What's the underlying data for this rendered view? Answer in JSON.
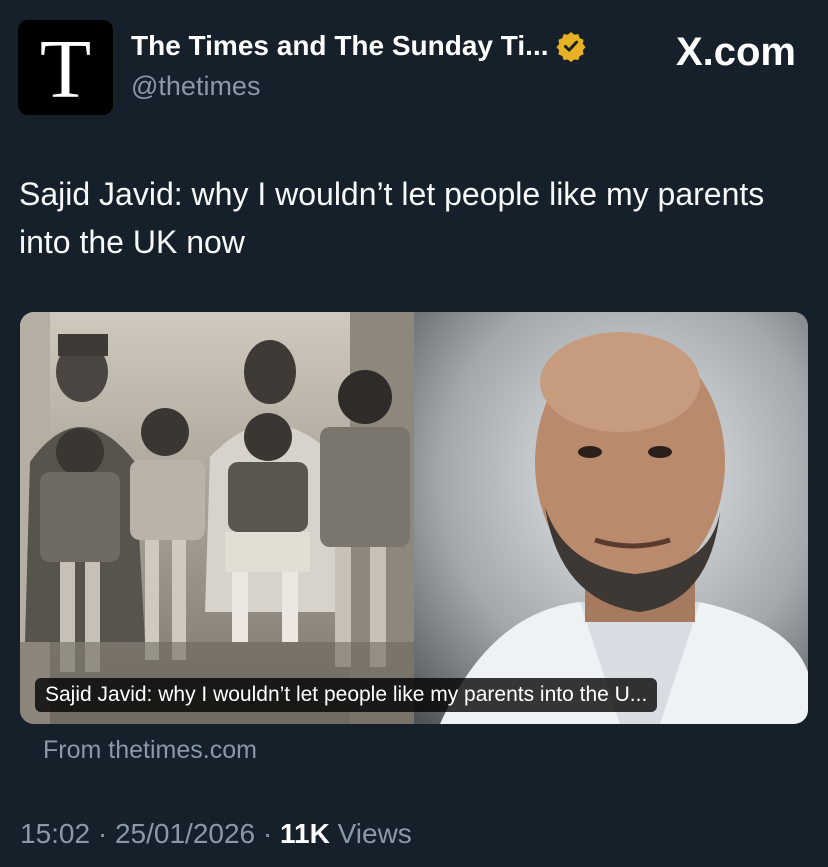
{
  "account": {
    "avatar_letter": "T",
    "display_name": "The Times and The Sunday Ti...",
    "handle": "@thetimes",
    "verified_color": "#e8b023"
  },
  "brand": {
    "label": "X.com"
  },
  "tweet": {
    "text": "Sajid Javid: why I wouldn’t let people like my parents into the UK now"
  },
  "link_card": {
    "caption": "Sajid Javid: why I wouldn’t let people like my parents into the U...",
    "source": "From thetimes.com"
  },
  "meta": {
    "time": "15:02",
    "separator": " · ",
    "date": "25/01/2026",
    "views_count": "11K",
    "views_label": "Views"
  },
  "colors": {
    "background": "#15202b",
    "secondary_text": "#8b98a5"
  }
}
